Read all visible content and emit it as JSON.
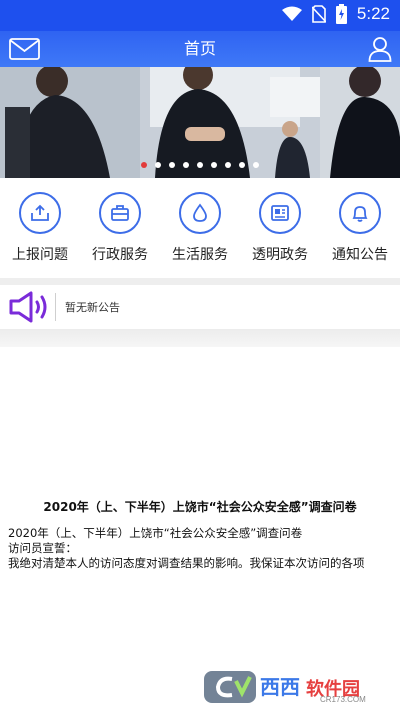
{
  "status_bar": {
    "time": "5:22"
  },
  "header": {
    "title": "首页"
  },
  "banner": {
    "slide_count": 9,
    "active_index": 0
  },
  "services": [
    {
      "label": "上报问题",
      "icon": "upload-tray-icon"
    },
    {
      "label": "行政服务",
      "icon": "briefcase-icon"
    },
    {
      "label": "生活服务",
      "icon": "water-drop-icon"
    },
    {
      "label": "透明政务",
      "icon": "news-card-icon"
    },
    {
      "label": "通知公告",
      "icon": "bell-icon"
    }
  ],
  "notice": {
    "text": "暂无新公告"
  },
  "article": {
    "title": "2020年（上、下半年）上饶市“社会公众安全感”调查问卷",
    "line1": "2020年（上、下半年）上饶市“社会公众安全感”调查问卷",
    "line2": "访问员宣誓：",
    "line3": "我绝对清楚本人的访问态度对调查结果的影响。我保证本次访问的各项"
  },
  "watermark": {
    "brand": "西西",
    "name": "软件园",
    "domain": "CR173.COM"
  },
  "colors": {
    "primary": "#1e50ee",
    "accent_blue": "#3d6de8",
    "speaker_purple": "#7a2bd9",
    "active_dot": "#e23b3b"
  }
}
